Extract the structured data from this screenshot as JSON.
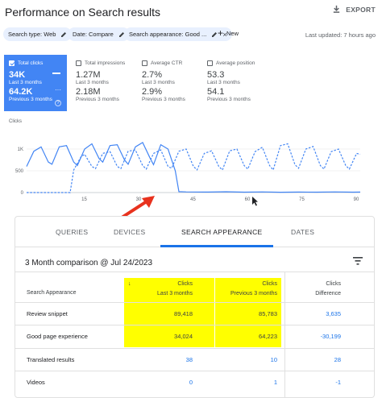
{
  "header": {
    "title": "Performance on Search results",
    "export_label": "EXPORT"
  },
  "filters": {
    "chips": [
      {
        "label": "Search type: Web"
      },
      {
        "label": "Date: Compare"
      },
      {
        "label": "Search appearance: Good ..."
      }
    ],
    "new_label": "New",
    "last_updated": "Last updated: 7 hours ago"
  },
  "metrics": [
    {
      "title": "Total clicks",
      "value1": "34K",
      "period1": "Last 3 months",
      "value2": "64.2K",
      "period2": "Previous 3 months",
      "selected": true
    },
    {
      "title": "Total impressions",
      "value1": "1.27M",
      "period1": "Last 3 months",
      "value2": "2.18M",
      "period2": "Previous 3 months",
      "selected": false
    },
    {
      "title": "Average CTR",
      "value1": "2.7%",
      "period1": "Last 3 months",
      "value2": "2.9%",
      "period2": "Previous 3 months",
      "selected": false
    },
    {
      "title": "Average position",
      "value1": "53.3",
      "period1": "Last 3 months",
      "value2": "54.1",
      "period2": "Previous 3 months",
      "selected": false
    }
  ],
  "colors": {
    "accent": "#4285f4",
    "link": "#1a73e8",
    "highlight": "#ffff00",
    "arrow": "#e8321e"
  },
  "chart_data": {
    "type": "line",
    "ylabel": "Clicks",
    "y_ticks": [
      "1.5K",
      "1K",
      "500",
      "0"
    ],
    "x_ticks": [
      "15",
      "30",
      "45",
      "60",
      "75",
      "90"
    ],
    "ylim": [
      0,
      1500
    ],
    "xlim": [
      0,
      92
    ],
    "series": [
      {
        "style": "solid",
        "values": [
          [
            0,
            600
          ],
          [
            2,
            950
          ],
          [
            4,
            1050
          ],
          [
            6,
            700
          ],
          [
            7,
            650
          ],
          [
            9,
            1050
          ],
          [
            11,
            1080
          ],
          [
            13,
            700
          ],
          [
            14,
            620
          ],
          [
            16,
            1000
          ],
          [
            18,
            1120
          ],
          [
            20,
            780
          ],
          [
            21,
            700
          ],
          [
            23,
            1080
          ],
          [
            25,
            1100
          ],
          [
            27,
            750
          ],
          [
            28,
            650
          ],
          [
            30,
            1050
          ],
          [
            32,
            1150
          ],
          [
            34,
            800
          ],
          [
            35,
            640
          ],
          [
            37,
            1100
          ],
          [
            39,
            1000
          ],
          [
            41,
            500
          ],
          [
            42,
            20
          ],
          [
            44,
            15
          ],
          [
            50,
            12
          ],
          [
            55,
            18
          ],
          [
            60,
            10
          ],
          [
            65,
            15
          ],
          [
            70,
            8
          ],
          [
            75,
            12
          ],
          [
            80,
            10
          ],
          [
            85,
            14
          ],
          [
            90,
            10
          ],
          [
            92,
            12
          ]
        ]
      },
      {
        "style": "dashed",
        "values": [
          [
            0,
            0
          ],
          [
            12,
            0
          ],
          [
            13,
            520
          ],
          [
            15,
            820
          ],
          [
            16,
            880
          ],
          [
            18,
            600
          ],
          [
            19,
            550
          ],
          [
            21,
            900
          ],
          [
            23,
            940
          ],
          [
            25,
            600
          ],
          [
            26,
            550
          ],
          [
            28,
            950
          ],
          [
            30,
            980
          ],
          [
            32,
            620
          ],
          [
            33,
            540
          ],
          [
            35,
            900
          ],
          [
            37,
            980
          ],
          [
            39,
            600
          ],
          [
            40,
            560
          ],
          [
            42,
            950
          ],
          [
            44,
            1000
          ],
          [
            46,
            600
          ],
          [
            47,
            520
          ],
          [
            49,
            900
          ],
          [
            51,
            960
          ],
          [
            53,
            600
          ],
          [
            54,
            520
          ],
          [
            56,
            960
          ],
          [
            58,
            1000
          ],
          [
            60,
            620
          ],
          [
            61,
            540
          ],
          [
            63,
            940
          ],
          [
            65,
            1040
          ],
          [
            67,
            620
          ],
          [
            68,
            520
          ],
          [
            70,
            1080
          ],
          [
            72,
            1120
          ],
          [
            74,
            640
          ],
          [
            75,
            560
          ],
          [
            77,
            1000
          ],
          [
            79,
            1060
          ],
          [
            81,
            620
          ],
          [
            82,
            540
          ],
          [
            84,
            940
          ],
          [
            86,
            1000
          ],
          [
            88,
            620
          ],
          [
            89,
            540
          ],
          [
            91,
            900
          ],
          [
            92,
            880
          ]
        ]
      }
    ]
  },
  "table": {
    "tabs": [
      {
        "label": "QUERIES"
      },
      {
        "label": "DEVICES"
      },
      {
        "label": "SEARCH APPEARANCE"
      },
      {
        "label": "DATES"
      }
    ],
    "active_tab": "SEARCH APPEARANCE",
    "comparison_title": "3 Month comparison @ Jul 24/2023",
    "columns": {
      "name": "Search Appearance",
      "col1_top": "Clicks",
      "col1_bottom": "Last 3 months",
      "col2_top": "Clicks",
      "col2_bottom": "Previous 3 months",
      "col3_top": "Clicks",
      "col3_bottom": "Difference"
    },
    "sort_arrow": "↓",
    "rows": [
      {
        "name": "Review snippet",
        "last": "89,418",
        "prev": "85,783",
        "diff": "3,635"
      },
      {
        "name": "Good page experience",
        "last": "34,024",
        "prev": "64,223",
        "diff": "-30,199"
      },
      {
        "name": "Translated results",
        "last": "38",
        "prev": "10",
        "diff": "28"
      },
      {
        "name": "Videos",
        "last": "0",
        "prev": "1",
        "diff": "-1"
      }
    ]
  }
}
